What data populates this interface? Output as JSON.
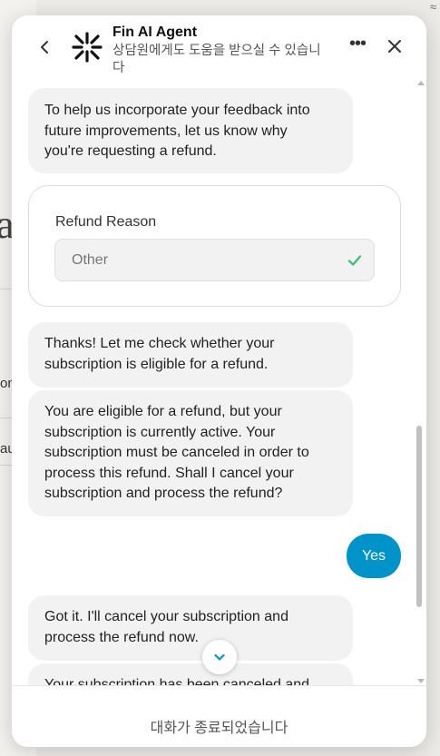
{
  "background": {
    "fragment_a": "a",
    "fragment_b": "on",
    "fragment_c": "au",
    "corner_glyph": "≈"
  },
  "header": {
    "title": "Fin AI Agent",
    "subtitle": "상담원에게도 도움을 받으실 수 있습니다",
    "back_icon": "chevron-left-icon",
    "more_icon": "more-horizontal-icon",
    "more_label": "•••",
    "close_icon": "close-icon",
    "logo_icon": "fin-logo-icon"
  },
  "messages": [
    {
      "sender": "bot",
      "lines": [
        "To help us incorporate your feedback into",
        "future improvements, let us know why",
        "you're requesting a refund."
      ]
    },
    {
      "sender": "bot",
      "lines": [
        "Thanks! Let me check whether your",
        "subscription is eligible for a refund."
      ]
    },
    {
      "sender": "bot",
      "lines": [
        "You are eligible for a refund, but your",
        "subscription is currently active. Your",
        "subscription must be canceled in order to",
        "process this refund. Shall I cancel your",
        "subscription and process the refund?"
      ]
    },
    {
      "sender": "user",
      "text": "Yes"
    },
    {
      "sender": "bot",
      "lines": [
        "Got it. I'll cancel your subscription and",
        "process the refund now."
      ]
    },
    {
      "sender": "bot",
      "lines": [
        "Your subscription has been canceled and"
      ]
    }
  ],
  "form": {
    "label": "Refund Reason",
    "value": "Other",
    "status_icon": "check-icon"
  },
  "footer": {
    "text": "대화가 종료되었습니다"
  },
  "colors": {
    "accent": "#0093c9",
    "check": "#3cc37a",
    "bubble": "#f2f2f2"
  }
}
